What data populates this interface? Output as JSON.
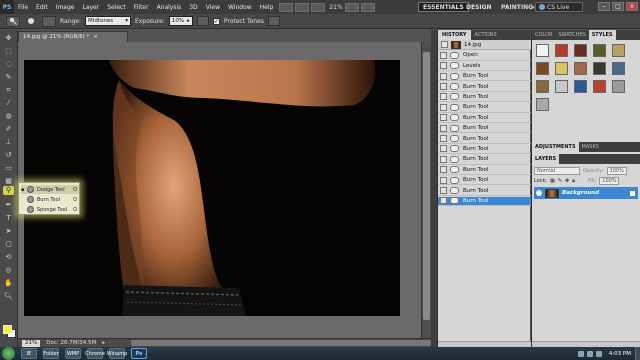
{
  "menubar": {
    "logo": "PS",
    "items": [
      "File",
      "Edit",
      "Image",
      "Layer",
      "Select",
      "Filter",
      "Analysis",
      "3D",
      "View",
      "Window",
      "Help"
    ],
    "zoom": "21%",
    "workspaces": [
      "ESSENTIALS",
      "DESIGN",
      "PAINTING",
      "»"
    ],
    "cslive": "CS Live"
  },
  "options": {
    "range_label": "Range:",
    "range_value": "Midtones",
    "exposure_label": "Exposure:",
    "exposure_value": "10%",
    "protect_tones_label": "Protect Tones",
    "protect_tones_checked": true
  },
  "document": {
    "tab_title": "14.jpg @ 21% (RGB/8) *",
    "zoom": "21%",
    "doc_size": "Doc: 26.7M/34.5M"
  },
  "flyout": {
    "items": [
      {
        "label": "Dodge Tool",
        "key": "O",
        "selected": true
      },
      {
        "label": "Burn Tool",
        "key": "O",
        "selected": false
      },
      {
        "label": "Sponge Tool",
        "key": "O",
        "selected": false
      }
    ]
  },
  "history": {
    "tabs": [
      "HISTORY",
      "ACTIONS"
    ],
    "snapshot": "14.jpg",
    "steps": [
      "Open",
      "Levels",
      "Burn Tool",
      "Burn Tool",
      "Burn Tool",
      "Burn Tool",
      "Burn Tool",
      "Burn Tool",
      "Burn Tool",
      "Burn Tool",
      "Burn Tool",
      "Burn Tool",
      "Burn Tool",
      "Burn Tool",
      "Burn Tool"
    ],
    "selected_index": 14
  },
  "styles": {
    "tabs": [
      "COLOR",
      "SWATCHES",
      "STYLES"
    ],
    "swatch_colors": [
      "#f3f3f3",
      "#b53a2a",
      "#6a2e1e",
      "#5b5b2a",
      "#b8a060",
      "#7a4a22",
      "#d9c46a",
      "#a06a4a",
      "#3a3a2a",
      "#4a6a8a",
      "#8a6a3a",
      "#c9c9c9",
      "#2a5a9a",
      "#c04030",
      "#9a9a9a",
      "#a8a8a8"
    ]
  },
  "adjustments": {
    "tabs": [
      "ADJUSTMENTS",
      "MASKS"
    ]
  },
  "layers": {
    "tabs": [
      "LAYERS"
    ],
    "blend_mode": "Normal",
    "opacity_label": "Opacity:",
    "opacity_value": "100%",
    "lock_label": "Lock:",
    "fill_label": "Fill:",
    "fill_value": "100%",
    "items": [
      {
        "name": "Background"
      }
    ]
  },
  "taskbar": {
    "apps": [
      "IE",
      "Folder",
      "WMP",
      "Chrome",
      "Winamp",
      "Ps"
    ],
    "clock": "4:03 PM"
  },
  "colors": {
    "foreground": "#f2f231",
    "background": "#fafafa",
    "selection": "#3b87d4"
  }
}
